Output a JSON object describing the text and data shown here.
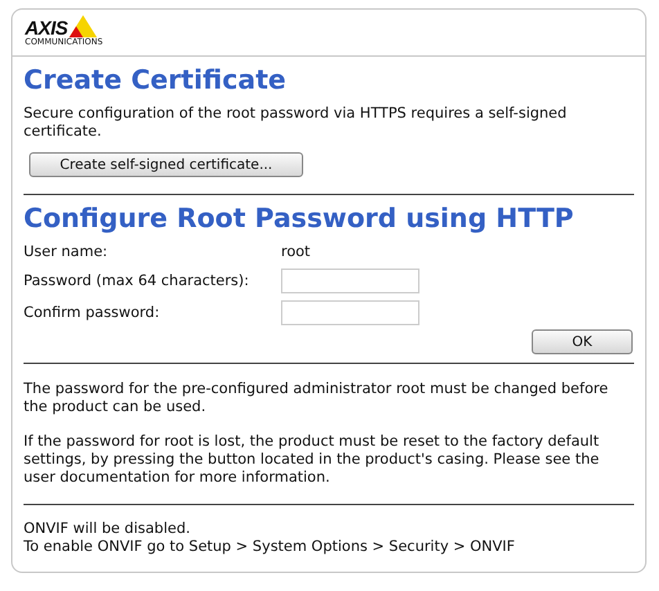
{
  "logo": {
    "wordmark": "AXIS",
    "tagline": "COMMUNICATIONS"
  },
  "certificate": {
    "title": "Create Certificate",
    "description": "Secure configuration of the root password via HTTPS requires a self-signed certificate.",
    "button": "Create self-signed certificate..."
  },
  "root_password": {
    "title": "Configure Root Password using HTTP",
    "fields": [
      {
        "kind": "text",
        "label": "User name:",
        "value": "root"
      },
      {
        "kind": "input",
        "label": "Password (max 64 characters):"
      },
      {
        "kind": "input",
        "label": "Confirm password:"
      }
    ],
    "button": "OK"
  },
  "notes": [
    "The password for the pre-configured administrator root must be changed before the product can be used.",
    "If the password for root is lost, the product must be reset to the factory default settings, by pressing the button located in the product's casing. Please see the user documentation for more information."
  ],
  "onvif": [
    "ONVIF will be disabled.",
    "To enable ONVIF go to Setup > System Options > Security > ONVIF"
  ]
}
